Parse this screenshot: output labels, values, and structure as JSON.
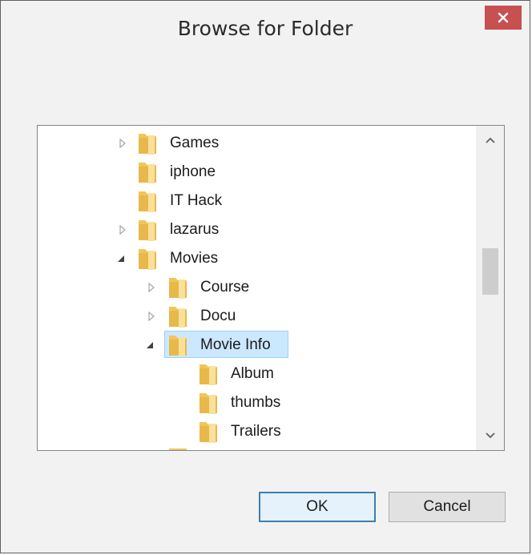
{
  "window": {
    "title": "Browse for Folder"
  },
  "tree": {
    "items": [
      {
        "label": "Games",
        "expander": "collapsed"
      },
      {
        "label": "iphone",
        "expander": "none"
      },
      {
        "label": "IT Hack",
        "expander": "none"
      },
      {
        "label": "lazarus",
        "expander": "collapsed"
      },
      {
        "label": "Movies",
        "expander": "expanded"
      },
      {
        "label": "Course",
        "expander": "collapsed"
      },
      {
        "label": "Docu",
        "expander": "collapsed"
      },
      {
        "label": "Movie Info",
        "expander": "expanded",
        "selected": true
      },
      {
        "label": "Album",
        "expander": "none"
      },
      {
        "label": "thumbs",
        "expander": "none"
      },
      {
        "label": "Trailers",
        "expander": "none"
      }
    ]
  },
  "buttons": {
    "ok_label": "OK",
    "cancel_label": "Cancel"
  },
  "colors": {
    "close": "#c75050",
    "selection": "#cce8ff",
    "folder": "#e8b84a",
    "ok_border": "#3c7fb1"
  }
}
